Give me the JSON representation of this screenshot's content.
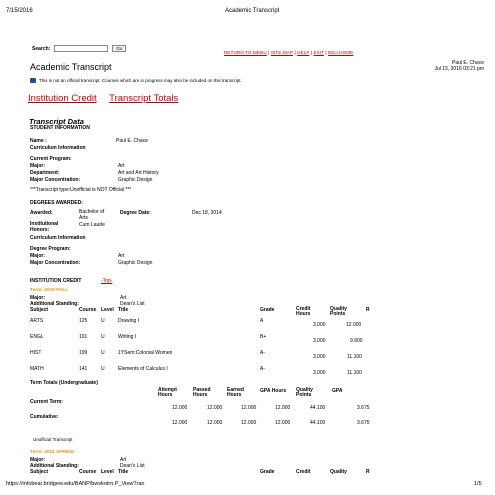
{
  "browser_header": {
    "date": "7/15/2016",
    "title": "Academic Transcript"
  },
  "search": {
    "label": "Search:",
    "placeholder": "",
    "button": "Go"
  },
  "top_links": [
    "RETURN TO MENU",
    "SITE MAP",
    "HELP",
    "EXIT",
    "BSU HOME"
  ],
  "page_title": "Academic Transcript",
  "user": {
    "name": "Paul E. Chace",
    "datetime": "Jul 15, 2016 03:21 pm"
  },
  "notice": "This is not an official transcript. Courses which are in progress may also be included on this transcript.",
  "tabs": [
    "Institution Credit",
    "Transcript Totals"
  ],
  "transcript_data_heading": "Transcript Data",
  "student_info_heading": "STUDENT INFORMATION",
  "name_label": "Name :",
  "name_value": "Paul E. Chace",
  "curriculum_info": "Curriculum Information",
  "current_program_label": "Current Program:",
  "program1": {
    "major_label": "Major:",
    "major": "Art",
    "department_label": "Department:",
    "department": "Art and Art History",
    "concentration_label": "Major Concentration:",
    "concentration": "Graphic Design"
  },
  "unofficial_note": "***Transcript type:Unofficial is NOT Official ***",
  "degrees_heading": "DEGREES AWARDED:",
  "awarded_label": "Awarded:",
  "awarded_degree_line1": "Bachelor of",
  "awarded_degree_line2": "Arts",
  "degree_date_label": "Degree Date:",
  "degree_date": "Dec 18, 2014",
  "honors_label_line1": "Institutional",
  "honors_label_line2": "Honors:",
  "honors_value": "Cum Laude",
  "curriculum_info2": "Curriculum Information",
  "degree_program_label": "Degree Program:",
  "program2": {
    "major_label": "Major:",
    "major": "Art",
    "concentration_label": "Major Concentration:",
    "concentration": "Graphic Design"
  },
  "institution_credit_heading": "INSTITUTION CREDIT",
  "top_link": "-Top-",
  "term1": {
    "title": "Term: 2010 FALL",
    "major_label": "Major:",
    "major": "Art",
    "standing_label": "Additional Standing:",
    "standing": "Dean's List"
  },
  "course_headers": {
    "subject": "Subject",
    "course": "Course",
    "level": "Level",
    "title": "Title",
    "grade": "Grade",
    "credit_hours_1": "Credit",
    "credit_hours_2": "Hours",
    "quality_points_1": "Quality",
    "quality_points_2": "Points",
    "r": "R"
  },
  "courses": [
    {
      "subject": "ARTS",
      "course": "125",
      "level": "U",
      "title": "Drawing I",
      "grade": "A",
      "credit": "3.000",
      "points": "12.000"
    },
    {
      "subject": "ENGL",
      "course": "101",
      "level": "U",
      "title": "Writing I",
      "grade": "B+",
      "credit": "3.000",
      "points": "9.900"
    },
    {
      "subject": "HIST",
      "course": "199",
      "level": "U",
      "title": "1YSem:Colonial Women",
      "grade": "A-",
      "credit": "3.000",
      "points": "11.100"
    },
    {
      "subject": "MATH",
      "course": "141",
      "level": "U",
      "title": "Elements of Calculus I",
      "grade": "A-",
      "credit": "3.000",
      "points": "11.100"
    }
  ],
  "term_totals_heading": "Term Totals (Undergraduate)",
  "totals_headers": [
    [
      "Attempt",
      "Hours"
    ],
    [
      "Passed",
      "Hours"
    ],
    [
      "Earned",
      "Hours"
    ],
    [
      "GPA Hours",
      ""
    ],
    [
      "Quality",
      "Points"
    ],
    [
      "GPA",
      ""
    ]
  ],
  "totals_rows": [
    {
      "label": "Current Term:",
      "values": [
        "12.000",
        "12.000",
        "12.000",
        "12.000",
        "44.100",
        "3.675"
      ]
    },
    {
      "label": "Cumulative:",
      "values": [
        "12.000",
        "12.000",
        "12.000",
        "12.000",
        "44.100",
        "3.675"
      ]
    }
  ],
  "unofficial_transcript": "Unofficial Transcript",
  "term2": {
    "title": "Term: 2011 SPRING",
    "major_label": "Major:",
    "major": "Art",
    "standing_label": "Additional Standing:",
    "standing": "Dean's List"
  },
  "footer": {
    "url": "https://infobear.bridgew.edu/BANP/bwskotrn.P_ViewTran",
    "page": "1/5"
  }
}
